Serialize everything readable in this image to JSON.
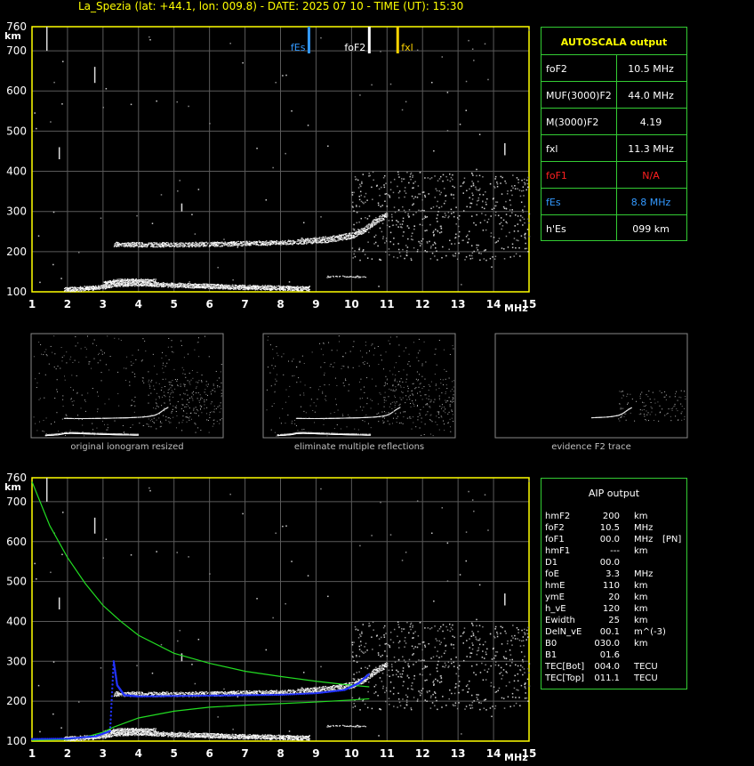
{
  "header": {
    "title": "La_Spezia (lat: +44.1, lon: 009.8) - DATE: 2025 07 10 - TIME (UT): 15:30"
  },
  "colors": {
    "axis": "#ffff00",
    "grid": "#5a5a5a",
    "table_border": "#33cc33",
    "foF1": "#ff2020",
    "fEs": "#3399ff",
    "fxl": "#ffd400",
    "model": "#22dd22",
    "trace": "#2233ff"
  },
  "axes": {
    "y_unit": "km",
    "x_unit": "MHz",
    "y_ticks": [
      "760",
      "700",
      "600",
      "500",
      "400",
      "300",
      "200",
      "100"
    ],
    "x_ticks": [
      "1",
      "2",
      "3",
      "4",
      "5",
      "6",
      "7",
      "8",
      "9",
      "10",
      "11",
      "12",
      "13",
      "14",
      "15"
    ]
  },
  "markers": [
    {
      "label": "fEs",
      "freq": 8.8,
      "color": "#3399ff"
    },
    {
      "label": "foF2",
      "freq": 10.5,
      "color": "#ffffff"
    },
    {
      "label": "fxl",
      "freq": 11.3,
      "color": "#ffd400"
    }
  ],
  "autoscala": {
    "title": "AUTOSCALA output",
    "rows": [
      {
        "label": "foF2",
        "value": "10.5 MHz",
        "color": "#ffffff"
      },
      {
        "label": "MUF(3000)F2",
        "value": "44.0 MHz",
        "color": "#ffffff"
      },
      {
        "label": "M(3000)F2",
        "value": "4.19",
        "color": "#ffffff"
      },
      {
        "label": "fxl",
        "value": "11.3 MHz",
        "color": "#ffffff"
      },
      {
        "label": "foF1",
        "value": "N/A",
        "color": "#ff2020"
      },
      {
        "label": "fEs",
        "value": "8.8 MHz",
        "color": "#3399ff"
      },
      {
        "label": "h'Es",
        "value": "099     km",
        "color": "#ffffff"
      }
    ]
  },
  "thumbnails": [
    {
      "caption": "original ionogram resized"
    },
    {
      "caption": "eliminate multiple reflections"
    },
    {
      "caption": "evidence F2 trace"
    }
  ],
  "aip": {
    "title": "AIP output",
    "rows": [
      {
        "label": "hmF2",
        "value": "200",
        "unit": "km",
        "extra": ""
      },
      {
        "label": "foF2",
        "value": "10.5",
        "unit": "MHz",
        "extra": ""
      },
      {
        "label": "foF1",
        "value": "00.0",
        "unit": "MHz",
        "extra": "[PN]"
      },
      {
        "label": "hmF1",
        "value": "---",
        "unit": "km",
        "extra": ""
      },
      {
        "label": "D1",
        "value": "00.0",
        "unit": "",
        "extra": ""
      },
      {
        "label": "foE",
        "value": "3.3",
        "unit": "MHz",
        "extra": ""
      },
      {
        "label": "hmE",
        "value": "110",
        "unit": "km",
        "extra": ""
      },
      {
        "label": "ymE",
        "value": "20",
        "unit": "km",
        "extra": ""
      },
      {
        "label": "h_vE",
        "value": "120",
        "unit": "km",
        "extra": ""
      },
      {
        "label": "Ewidth",
        "value": "25",
        "unit": "km",
        "extra": ""
      },
      {
        "label": "DelN_vE",
        "value": "00.1",
        "unit": "m^(-3)",
        "extra": ""
      },
      {
        "label": "B0",
        "value": "030.0",
        "unit": "km",
        "extra": ""
      },
      {
        "label": "B1",
        "value": "01.6",
        "unit": "",
        "extra": ""
      },
      {
        "label": "TEC[Bot]",
        "value": "004.0",
        "unit": "TECU",
        "extra": ""
      },
      {
        "label": "TEC[Top]",
        "value": "011.1",
        "unit": "TECU",
        "extra": ""
      }
    ]
  },
  "chart_data": [
    {
      "type": "scatter",
      "name": "ionogram-top",
      "xlim": [
        1,
        15
      ],
      "ylim": [
        100,
        760
      ],
      "traces": [
        {
          "layer": "E",
          "x": [
            1.9,
            2.5,
            3.0,
            3.3,
            3.8,
            4.5,
            5.5,
            6.5,
            7.5,
            8.5,
            8.8
          ],
          "y": [
            105,
            108,
            112,
            118,
            120,
            118,
            115,
            112,
            110,
            108,
            108
          ]
        },
        {
          "layer": "F",
          "x": [
            3.3,
            4.0,
            5.0,
            6.0,
            7.0,
            8.0,
            9.0,
            9.5,
            10.0,
            10.3,
            10.5,
            10.7,
            11.0
          ],
          "y": [
            218,
            217,
            217,
            218,
            220,
            222,
            226,
            230,
            238,
            250,
            262,
            275,
            290
          ]
        },
        {
          "layer": "Es2",
          "x": [
            9.3,
            9.7,
            10.1,
            10.4
          ],
          "y": [
            140,
            140,
            142,
            142
          ]
        }
      ]
    },
    {
      "type": "line",
      "name": "ionogram-bottom-model",
      "xlim": [
        1,
        15
      ],
      "ylim": [
        100,
        760
      ],
      "series": [
        {
          "x": [
            1.0,
            1.5,
            2.0,
            2.5,
            3.0,
            3.5,
            4.0,
            5.0,
            6.0,
            7.0,
            8.0,
            9.0,
            10.0,
            10.5
          ],
          "y": [
            750,
            640,
            560,
            495,
            440,
            400,
            365,
            320,
            295,
            275,
            262,
            250,
            240,
            236
          ]
        },
        {
          "x": [
            1.0,
            2.0,
            2.5,
            3.0,
            3.3,
            4.0,
            5.0,
            6.0,
            7.0,
            8.0,
            9.0,
            10.0,
            10.5
          ],
          "y": [
            102,
            104,
            110,
            122,
            135,
            158,
            175,
            185,
            190,
            194,
            198,
            203,
            206
          ]
        }
      ],
      "trace": [
        {
          "x": [
            1.0,
            2.0,
            2.8,
            3.2,
            3.3,
            3.4,
            3.6,
            4.0,
            5.0,
            6.0,
            7.0,
            8.0,
            9.0,
            9.8,
            10.2,
            10.5
          ],
          "y": [
            105,
            106,
            112,
            125,
            300,
            240,
            215,
            212,
            213,
            214,
            215,
            216,
            220,
            228,
            245,
            268
          ]
        }
      ]
    }
  ]
}
